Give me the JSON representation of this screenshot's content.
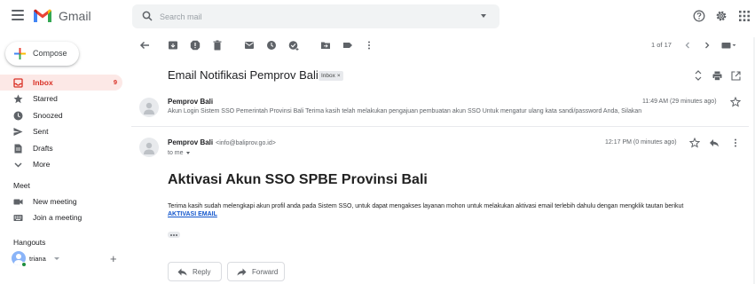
{
  "header": {
    "app_name": "Gmail",
    "search_placeholder": "Search mail"
  },
  "sidebar": {
    "compose_label": "Compose",
    "items": [
      {
        "label": "Inbox",
        "count": "9",
        "icon": "inbox-icon"
      },
      {
        "label": "Starred",
        "icon": "star-icon"
      },
      {
        "label": "Snoozed",
        "icon": "clock-icon"
      },
      {
        "label": "Sent",
        "icon": "send-icon"
      },
      {
        "label": "Drafts",
        "icon": "draft-icon"
      },
      {
        "label": "More",
        "icon": "chevron-down-icon"
      }
    ],
    "meet": {
      "title": "Meet",
      "items": [
        {
          "label": "New meeting",
          "icon": "video-icon"
        },
        {
          "label": "Join a meeting",
          "icon": "keyboard-icon"
        }
      ]
    },
    "hangouts": {
      "title": "Hangouts",
      "user": "triana"
    }
  },
  "toolbar": {
    "pager": "1 of 17"
  },
  "email": {
    "subject": "Email Notifikasi Pemprov Bali",
    "label": "Inbox",
    "label_close": "×",
    "messages": [
      {
        "sender": "Pemprov Bali",
        "snippet": "Akun Login Sistem SSO Pemerintah Provinsi Bali Terima kasih telah melakukan pengajuan pembuatan akun SSO Untuk mengatur ulang kata sandi/password Anda, Silakan",
        "time": "11:49 AM (29 minutes ago)"
      },
      {
        "sender": "Pemprov Bali",
        "sender_email": "<info@baliprov.go.id>",
        "to": "to me",
        "time": "12:17 PM (0 minutes ago)"
      }
    ],
    "body": {
      "title": "Aktivasi Akun SSO SPBE Provinsi Bali",
      "text": "Terima kasih sudah melengkapi akun profil anda pada Sistem SSO, untuk dapat mengakses layanan mohon untuk melakukan aktivasi email terlebih dahulu dengan mengklik tautan berikut",
      "link": "AKTIVASI EMAIL"
    },
    "reply_label": "Reply",
    "forward_label": "Forward"
  },
  "colors": {
    "accent_red": "#d93025",
    "active_bg": "#fce8e6",
    "link_blue": "#1155cc"
  }
}
